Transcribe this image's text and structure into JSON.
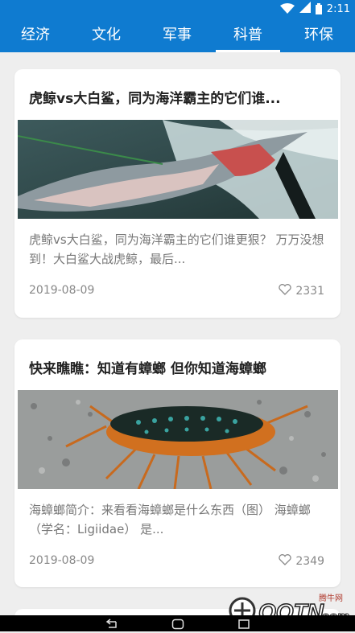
{
  "status": {
    "time": "2:11"
  },
  "tabs": [
    {
      "label": "经济",
      "active": false
    },
    {
      "label": "文化",
      "active": false
    },
    {
      "label": "军事",
      "active": false
    },
    {
      "label": "科普",
      "active": true
    },
    {
      "label": "环保",
      "active": false
    }
  ],
  "articles": [
    {
      "title": "虎鲸vs大白鲨，同为海洋霸主的它们谁...",
      "summary": "  虎鲸vs大白鲨，同为海洋霸主的它们谁更狠？  万万没想到！大白鲨大战虎鲸，最后...",
      "date": "2019-08-09",
      "likes": "2331",
      "image_icon": "shark-photo"
    },
    {
      "title": "快来瞧瞧：知道有蟑螂 但你知道海蟑螂",
      "summary": "   海蟑螂简介：来看看海蟑螂是什么东西（图）   海蟑螂（学名：Ligiidae）  是...",
      "date": "2019-08-09",
      "likes": "2349",
      "image_icon": "sea-cockroach-photo"
    }
  ],
  "watermark": {
    "top_text": "腾牛网",
    "brand": "QQTN",
    "suffix": ".com"
  },
  "colors": {
    "accent": "#0f7bd0"
  }
}
